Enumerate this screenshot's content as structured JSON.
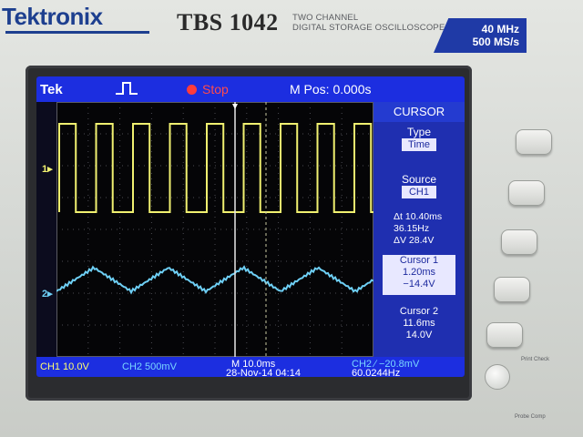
{
  "device": {
    "brand": "Tektronix",
    "model": "TBS 1042",
    "description_line1": "TWO CHANNEL",
    "description_line2": "DIGITAL STORAGE OSCILLOSCOPE",
    "spec_bandwidth": "40 MHz",
    "spec_sample_rate": "500 MS/s"
  },
  "topbar": {
    "brand_short": "Tek",
    "status": "Stop",
    "m_pos": "M Pos: 0.000s"
  },
  "side_menu": {
    "title": "CURSOR",
    "type_label": "Type",
    "type_value": "Time",
    "source_label": "Source",
    "source_value": "CH1",
    "delta_t": "Δt 10.40ms",
    "one_over_delta_t": "36.15Hz",
    "delta_v": "ΔV 28.4V",
    "cursor1": {
      "label": "Cursor 1",
      "time": "1.20ms",
      "volts": "−14.4V"
    },
    "cursor2": {
      "label": "Cursor 2",
      "time": "11.6ms",
      "volts": "14.0V"
    }
  },
  "bottombar": {
    "ch1": "CH1  10.0V",
    "ch2": "CH2  500mV",
    "timebase": "M 10.0ms",
    "timestamp": "28-Nov-14 04:14",
    "trigger": "CH2 ∕ −20.8mV",
    "frequency": "60.0244Hz"
  },
  "markers": {
    "ch1": "1▸",
    "ch2": "2▸"
  },
  "labels": {
    "print_button": "Print Check",
    "probe_comp": "Probe Comp"
  },
  "colors": {
    "ch1_trace": "#f0f070",
    "ch2_trace": "#6ecff5",
    "menu_blue": "#1c2ee0",
    "stop_red": "#ff3b3b"
  }
}
